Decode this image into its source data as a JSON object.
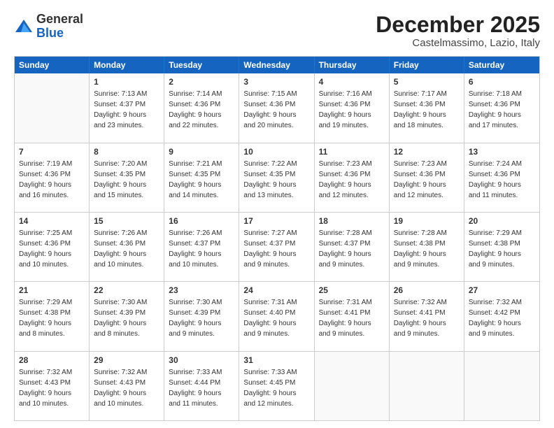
{
  "header": {
    "logo_general": "General",
    "logo_blue": "Blue",
    "month_title": "December 2025",
    "location": "Castelmassimo, Lazio, Italy"
  },
  "days_of_week": [
    "Sunday",
    "Monday",
    "Tuesday",
    "Wednesday",
    "Thursday",
    "Friday",
    "Saturday"
  ],
  "weeks": [
    [
      {
        "day": "",
        "empty": true,
        "text": ""
      },
      {
        "day": "1",
        "text": "Sunrise: 7:13 AM\nSunset: 4:37 PM\nDaylight: 9 hours\nand 23 minutes."
      },
      {
        "day": "2",
        "text": "Sunrise: 7:14 AM\nSunset: 4:36 PM\nDaylight: 9 hours\nand 22 minutes."
      },
      {
        "day": "3",
        "text": "Sunrise: 7:15 AM\nSunset: 4:36 PM\nDaylight: 9 hours\nand 20 minutes."
      },
      {
        "day": "4",
        "text": "Sunrise: 7:16 AM\nSunset: 4:36 PM\nDaylight: 9 hours\nand 19 minutes."
      },
      {
        "day": "5",
        "text": "Sunrise: 7:17 AM\nSunset: 4:36 PM\nDaylight: 9 hours\nand 18 minutes."
      },
      {
        "day": "6",
        "text": "Sunrise: 7:18 AM\nSunset: 4:36 PM\nDaylight: 9 hours\nand 17 minutes."
      }
    ],
    [
      {
        "day": "7",
        "text": "Sunrise: 7:19 AM\nSunset: 4:36 PM\nDaylight: 9 hours\nand 16 minutes."
      },
      {
        "day": "8",
        "text": "Sunrise: 7:20 AM\nSunset: 4:35 PM\nDaylight: 9 hours\nand 15 minutes."
      },
      {
        "day": "9",
        "text": "Sunrise: 7:21 AM\nSunset: 4:35 PM\nDaylight: 9 hours\nand 14 minutes."
      },
      {
        "day": "10",
        "text": "Sunrise: 7:22 AM\nSunset: 4:35 PM\nDaylight: 9 hours\nand 13 minutes."
      },
      {
        "day": "11",
        "text": "Sunrise: 7:23 AM\nSunset: 4:36 PM\nDaylight: 9 hours\nand 12 minutes."
      },
      {
        "day": "12",
        "text": "Sunrise: 7:23 AM\nSunset: 4:36 PM\nDaylight: 9 hours\nand 12 minutes."
      },
      {
        "day": "13",
        "text": "Sunrise: 7:24 AM\nSunset: 4:36 PM\nDaylight: 9 hours\nand 11 minutes."
      }
    ],
    [
      {
        "day": "14",
        "text": "Sunrise: 7:25 AM\nSunset: 4:36 PM\nDaylight: 9 hours\nand 10 minutes."
      },
      {
        "day": "15",
        "text": "Sunrise: 7:26 AM\nSunset: 4:36 PM\nDaylight: 9 hours\nand 10 minutes."
      },
      {
        "day": "16",
        "text": "Sunrise: 7:26 AM\nSunset: 4:37 PM\nDaylight: 9 hours\nand 10 minutes."
      },
      {
        "day": "17",
        "text": "Sunrise: 7:27 AM\nSunset: 4:37 PM\nDaylight: 9 hours\nand 9 minutes."
      },
      {
        "day": "18",
        "text": "Sunrise: 7:28 AM\nSunset: 4:37 PM\nDaylight: 9 hours\nand 9 minutes."
      },
      {
        "day": "19",
        "text": "Sunrise: 7:28 AM\nSunset: 4:38 PM\nDaylight: 9 hours\nand 9 minutes."
      },
      {
        "day": "20",
        "text": "Sunrise: 7:29 AM\nSunset: 4:38 PM\nDaylight: 9 hours\nand 9 minutes."
      }
    ],
    [
      {
        "day": "21",
        "text": "Sunrise: 7:29 AM\nSunset: 4:38 PM\nDaylight: 9 hours\nand 8 minutes."
      },
      {
        "day": "22",
        "text": "Sunrise: 7:30 AM\nSunset: 4:39 PM\nDaylight: 9 hours\nand 8 minutes."
      },
      {
        "day": "23",
        "text": "Sunrise: 7:30 AM\nSunset: 4:39 PM\nDaylight: 9 hours\nand 9 minutes."
      },
      {
        "day": "24",
        "text": "Sunrise: 7:31 AM\nSunset: 4:40 PM\nDaylight: 9 hours\nand 9 minutes."
      },
      {
        "day": "25",
        "text": "Sunrise: 7:31 AM\nSunset: 4:41 PM\nDaylight: 9 hours\nand 9 minutes."
      },
      {
        "day": "26",
        "text": "Sunrise: 7:32 AM\nSunset: 4:41 PM\nDaylight: 9 hours\nand 9 minutes."
      },
      {
        "day": "27",
        "text": "Sunrise: 7:32 AM\nSunset: 4:42 PM\nDaylight: 9 hours\nand 9 minutes."
      }
    ],
    [
      {
        "day": "28",
        "text": "Sunrise: 7:32 AM\nSunset: 4:43 PM\nDaylight: 9 hours\nand 10 minutes."
      },
      {
        "day": "29",
        "text": "Sunrise: 7:32 AM\nSunset: 4:43 PM\nDaylight: 9 hours\nand 10 minutes."
      },
      {
        "day": "30",
        "text": "Sunrise: 7:33 AM\nSunset: 4:44 PM\nDaylight: 9 hours\nand 11 minutes."
      },
      {
        "day": "31",
        "text": "Sunrise: 7:33 AM\nSunset: 4:45 PM\nDaylight: 9 hours\nand 12 minutes."
      },
      {
        "day": "",
        "empty": true,
        "text": ""
      },
      {
        "day": "",
        "empty": true,
        "text": ""
      },
      {
        "day": "",
        "empty": true,
        "text": ""
      }
    ]
  ]
}
